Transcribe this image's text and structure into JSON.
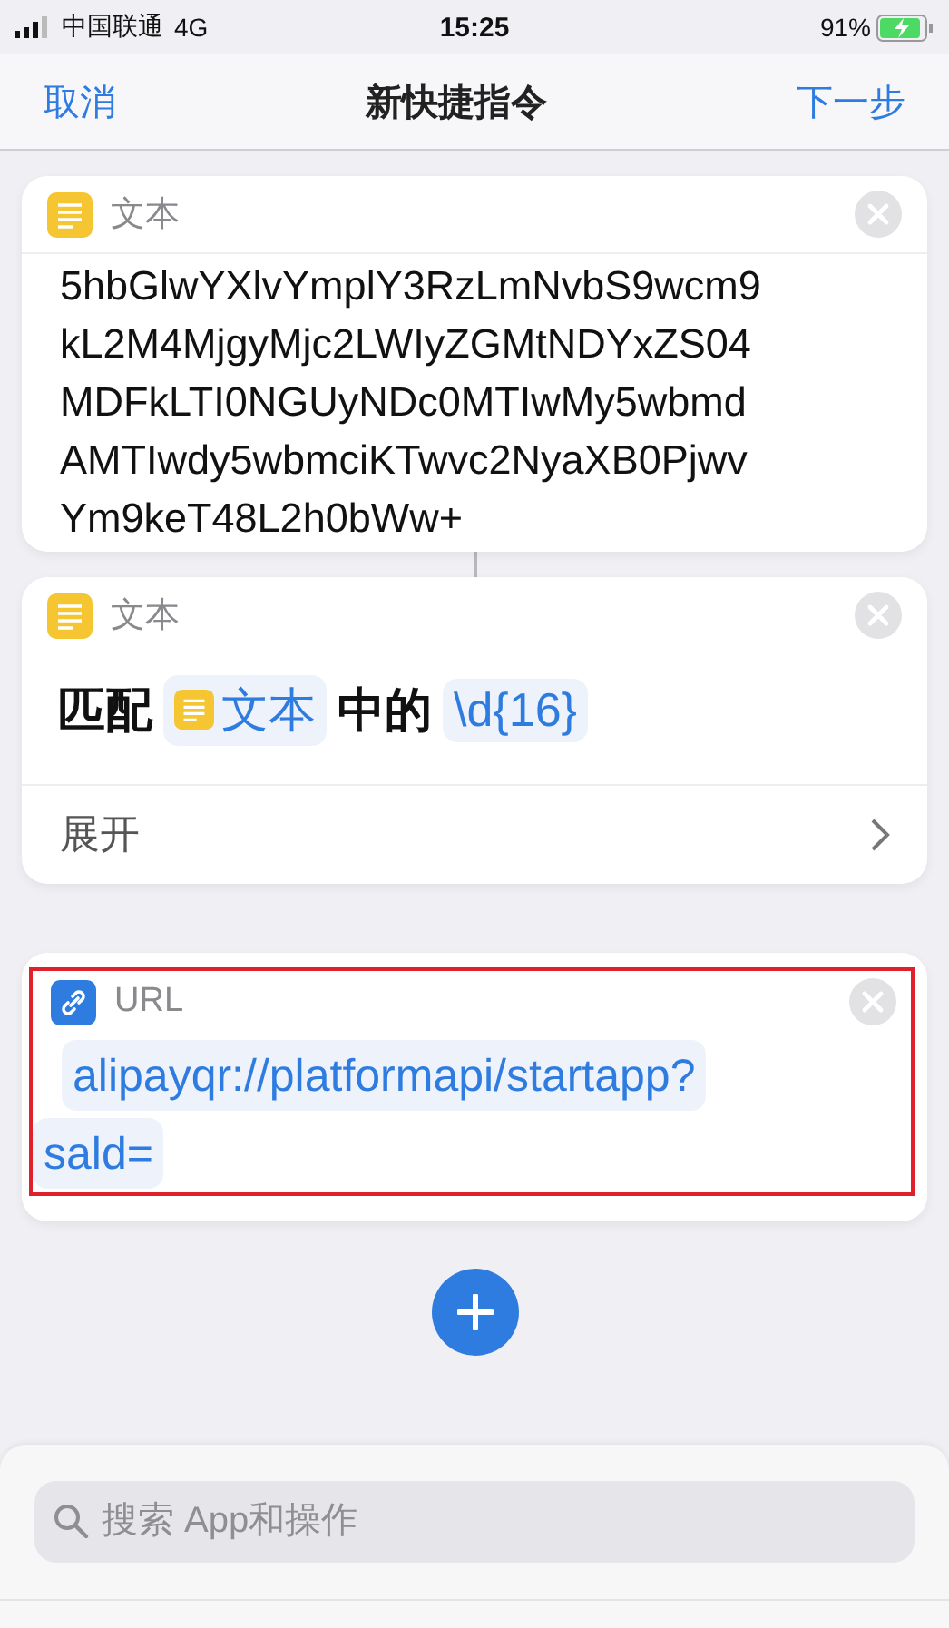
{
  "status_bar": {
    "carrier": "中国联通",
    "network": "4G",
    "time": "15:25",
    "battery": "91%",
    "charging": true
  },
  "nav": {
    "cancel": "取消",
    "title": "新快捷指令",
    "next": "下一步"
  },
  "actions": [
    {
      "kind": "text",
      "title": "文本",
      "lines": [
        "5hbGlwYXlvYmplY3RzLmNvbS9wcm9",
        "kL2M4MjgyMjc2LWIyZGMtNDYxZS04",
        "MDFkLTI0NGUyNDc0MTIwMy5wbmd",
        "AMTIwdy5wbmciKTwvc2NyaXB0Pjwv",
        "Ym9keT48L2h0bWw+"
      ]
    },
    {
      "kind": "match",
      "title": "文本",
      "parts": [
        {
          "kind": "word",
          "text": "匹配"
        },
        {
          "kind": "variable",
          "text": "文本"
        },
        {
          "kind": "word",
          "text": "中的"
        },
        {
          "kind": "token",
          "text": "\\d{16}"
        }
      ],
      "expand": "展开"
    },
    {
      "kind": "url",
      "title": "URL",
      "tokens": [
        "alipayqr://platformapi/startapp?",
        "sald="
      ],
      "highlighted": true
    }
  ],
  "search": {
    "placeholder": "搜索 App和操作"
  }
}
